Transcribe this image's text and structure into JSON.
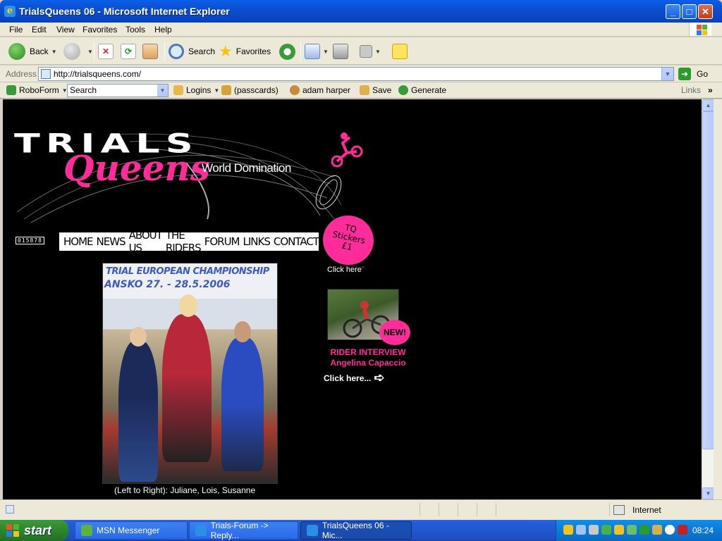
{
  "window": {
    "title": "TrialsQueens 06 - Microsoft Internet Explorer"
  },
  "menu": [
    "File",
    "Edit",
    "View",
    "Favorites",
    "Tools",
    "Help"
  ],
  "toolbar": {
    "back_label": "Back",
    "search_label": "Search",
    "favorites_label": "Favorites"
  },
  "address": {
    "label": "Address",
    "url": "http://trialsqueens.com/",
    "go_label": "Go"
  },
  "roboform": {
    "brand": "RoboForm",
    "search_value": "Search",
    "logins_label": "Logins",
    "passcards_label": "(passcards)",
    "identity_label": "adam harper",
    "save_label": "Save",
    "generate_label": "Generate",
    "links_label": "Links"
  },
  "page": {
    "logo_world": "World Domination",
    "counter": "015878",
    "nav": [
      "HOME",
      "NEWS",
      "ABOUT US",
      "THE RIDERS",
      "FORUM",
      "LINKS",
      "CONTACT"
    ],
    "sticker": {
      "line1": "TQ",
      "line2": "Stickers",
      "line3": "£1",
      "link": "Click here",
      "caret": "^"
    },
    "photo_caption": "(Left to Right): Juliane, Lois, Susanne",
    "photo_banner": {
      "line1": "TRIAL EUROPEAN CHAMPIONSHIP",
      "line2": "ANSKO 27. - 28.5.2006"
    },
    "interview": {
      "badge": "NEW!",
      "line1": "RIDER INTERVIEW",
      "line2": "Angelina Capaccio",
      "click": "Click here..."
    }
  },
  "status": {
    "zone": "Internet"
  },
  "taskbar": {
    "start": "start",
    "tasks": [
      "MSN Messenger",
      "Trials-Forum -> Reply...",
      "TrialsQueens 06 - Mic..."
    ],
    "clock": "08:24"
  },
  "colors": {
    "accent_pink": "#ff2c9a",
    "page_bg": "#000000",
    "xp_blue": "#245edb"
  }
}
